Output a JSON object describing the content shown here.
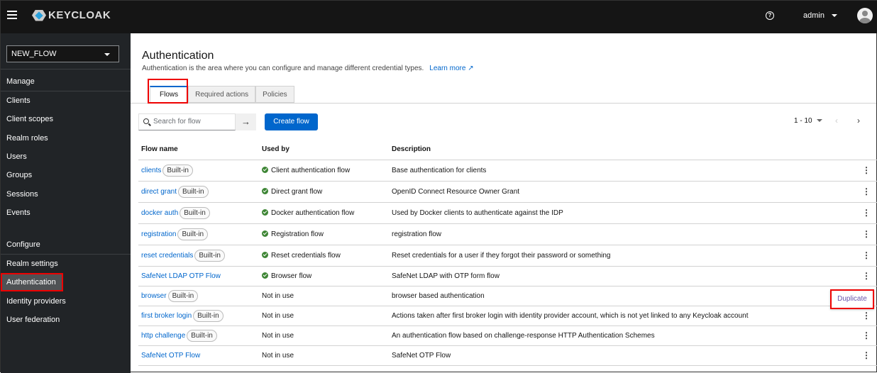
{
  "header": {
    "brand": "KEYCLOAK",
    "user": "admin"
  },
  "sidebar": {
    "realm": "NEW_FLOW",
    "manage_label": "Manage",
    "manage": [
      "Clients",
      "Client scopes",
      "Realm roles",
      "Users",
      "Groups",
      "Sessions",
      "Events"
    ],
    "configure_label": "Configure",
    "configure": [
      "Realm settings",
      "Authentication",
      "Identity providers",
      "User federation"
    ],
    "active": "Authentication"
  },
  "page": {
    "title": "Authentication",
    "subtitle": "Authentication is the area where you can configure and manage different credential types.",
    "learn_more": "Learn more"
  },
  "tabs": [
    "Flows",
    "Required actions",
    "Policies"
  ],
  "toolbar": {
    "search_placeholder": "Search for flow",
    "create": "Create flow",
    "pagination": "1 - 10"
  },
  "table": {
    "headers": [
      "Flow name",
      "Used by",
      "Description"
    ],
    "rows": [
      {
        "name": "clients",
        "badge": "Built-in",
        "used_by": "Client authentication flow",
        "used": true,
        "description": "Base authentication for clients"
      },
      {
        "name": "direct grant",
        "badge": "Built-in",
        "used_by": "Direct grant flow",
        "used": true,
        "description": "OpenID Connect Resource Owner Grant"
      },
      {
        "name": "docker auth",
        "badge": "Built-in",
        "used_by": "Docker authentication flow",
        "used": true,
        "description": "Used by Docker clients to authenticate against the IDP"
      },
      {
        "name": "registration",
        "badge": "Built-in",
        "used_by": "Registration flow",
        "used": true,
        "description": "registration flow"
      },
      {
        "name": "reset credentials",
        "badge": "Built-in",
        "used_by": "Reset credentials flow",
        "used": true,
        "description": "Reset credentials for a user if they forgot their password or something"
      },
      {
        "name": "SafeNet LDAP OTP Flow",
        "badge": "",
        "used_by": "Browser flow",
        "used": true,
        "description": "SafeNet LDAP with OTP form flow"
      },
      {
        "name": "browser",
        "badge": "Built-in",
        "used_by": "Not in use",
        "used": false,
        "description": "browser based authentication"
      },
      {
        "name": "first broker login",
        "badge": "Built-in",
        "used_by": "Not in use",
        "used": false,
        "description": "Actions taken after first broker login with identity provider account, which is not yet linked to any Keycloak account"
      },
      {
        "name": "http challenge",
        "badge": "Built-in",
        "used_by": "Not in use",
        "used": false,
        "description": "An authentication flow based on challenge-response HTTP Authentication Schemes"
      },
      {
        "name": "SafeNet OTP Flow",
        "badge": "",
        "used_by": "Not in use",
        "used": false,
        "description": "SafeNet OTP Flow"
      }
    ]
  },
  "menu": {
    "duplicate": "Duplicate"
  }
}
